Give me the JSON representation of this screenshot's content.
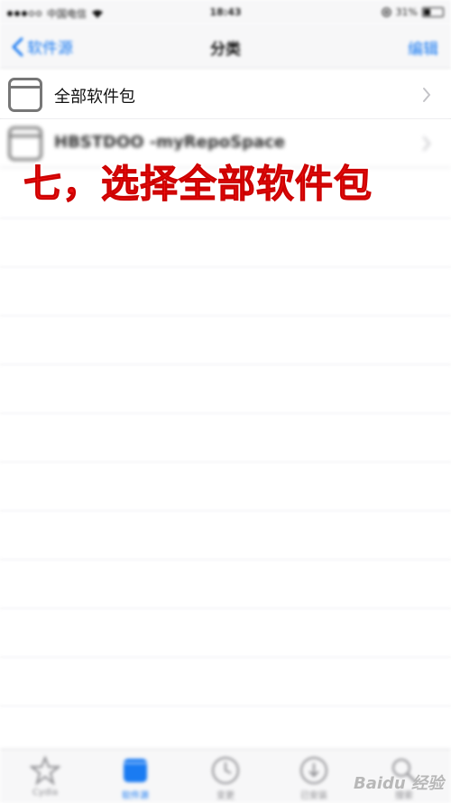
{
  "status_bar": {
    "carrier": "中国电信",
    "time": "18:43",
    "battery": "31%"
  },
  "nav": {
    "back_label": "软件源",
    "title": "分类",
    "edit_label": "编辑"
  },
  "list": {
    "items": [
      {
        "label": "全部软件包",
        "icon": "folder-icon"
      },
      {
        "label": "HBSTDOO -myRepoSpace",
        "icon": "folder-icon"
      }
    ]
  },
  "annotation": {
    "text": "七，选择全部软件包"
  },
  "tab_bar": {
    "tabs": [
      {
        "label": "Cydia",
        "icon": "star-icon",
        "active": false
      },
      {
        "label": "软件源",
        "icon": "sources-icon",
        "active": true
      },
      {
        "label": "变更",
        "icon": "clock-icon",
        "active": false
      },
      {
        "label": "已安装",
        "icon": "download-icon",
        "active": false
      },
      {
        "label": "搜索",
        "icon": "search-icon",
        "active": false
      }
    ]
  },
  "watermark": {
    "text": "Baidu 经验"
  },
  "colors": {
    "accent": "#1a7bf2",
    "annotation": "#ee1111"
  }
}
